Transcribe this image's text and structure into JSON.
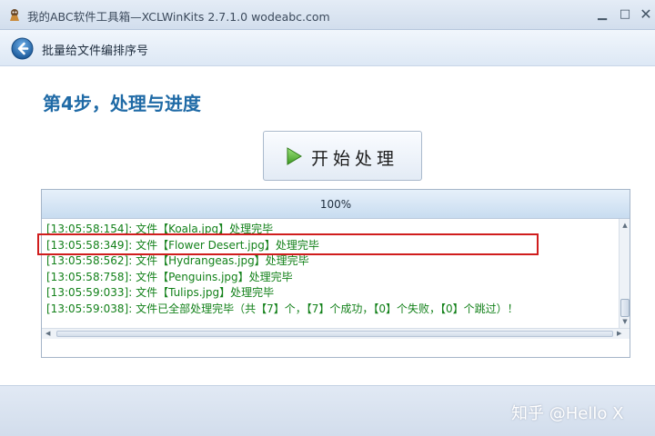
{
  "window": {
    "title": "我的ABC软件工具箱—XCLWinKits 2.7.1.0  wodeabc.com",
    "min_glyph": "▁",
    "max_glyph": "□",
    "close_glyph": "✕"
  },
  "nav": {
    "title": "批量给文件编排序号"
  },
  "step": {
    "title": "第4步，处理与进度"
  },
  "start_button": {
    "label": "开始处理"
  },
  "progress": {
    "text": "100%",
    "value": 1.0
  },
  "log": {
    "lines": [
      "[13:05:58:154]: 文件【Koala.jpg】处理完毕",
      "[13:05:58:349]: 文件【Flower Desert.jpg】处理完毕",
      "[13:05:58:562]: 文件【Hydrangeas.jpg】处理完毕",
      "[13:05:58:758]: 文件【Penguins.jpg】处理完毕",
      "[13:05:59:033]: 文件【Tulips.jpg】处理完毕",
      "[13:05:59:038]: 文件已全部处理完毕（共【7】个，【7】个成功，【0】个失败，【0】个跳过）！"
    ]
  },
  "footer": {
    "watermark": "知乎 @Hello X"
  },
  "colors": {
    "step_title": "#1f6aa6",
    "log_text": "#13811a",
    "highlight": "#d01d1d"
  },
  "icons": {
    "app": "app-icon",
    "back": "back-arrow-icon",
    "play": "play-icon"
  }
}
